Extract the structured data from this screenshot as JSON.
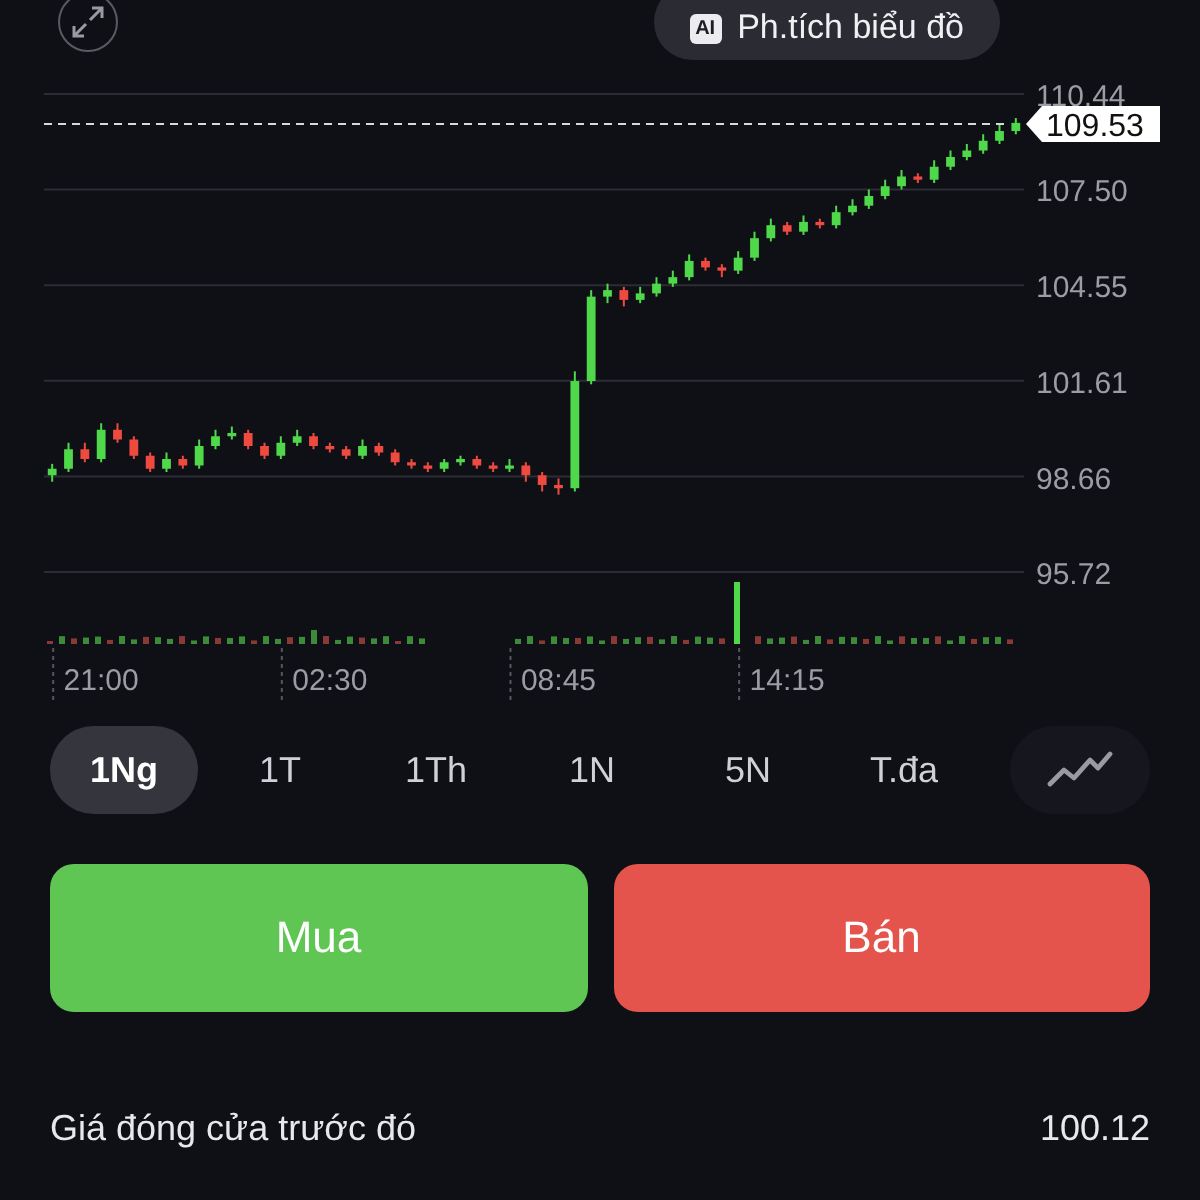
{
  "top_bar": {
    "ai_button": {
      "badge": "AI",
      "label": "Ph.tích biểu đồ"
    }
  },
  "chart": {
    "current_price": "109.53",
    "chart_data": {
      "type": "candlestick",
      "grid": true,
      "ylim": [
        95.72,
        110.44
      ],
      "categories": [
        null,
        null,
        null,
        "21:00",
        null,
        null,
        null,
        null,
        null,
        null,
        null,
        null,
        null,
        null,
        null,
        null,
        null,
        "02:30",
        null,
        null,
        null,
        null,
        null,
        null,
        null,
        null,
        null,
        null,
        null,
        null,
        null,
        "08:45",
        null,
        null,
        null,
        null,
        null,
        null,
        null,
        null,
        null,
        null,
        null,
        null,
        null,
        "14:15",
        null,
        null,
        null,
        null,
        null,
        null,
        null,
        null,
        null,
        null,
        null,
        null,
        null,
        null
      ],
      "yticks": [
        95.72,
        98.66,
        101.61,
        104.55,
        {
          "value": 107.5,
          "label": "107.50"
        },
        110.44
      ],
      "ohlc": [
        [
          98.7,
          99.05,
          98.5,
          98.9
        ],
        [
          98.9,
          99.7,
          98.8,
          99.5
        ],
        [
          99.5,
          99.7,
          99.1,
          99.2
        ],
        [
          99.2,
          100.3,
          99.1,
          100.1
        ],
        [
          100.1,
          100.3,
          99.7,
          99.8
        ],
        [
          99.8,
          99.9,
          99.2,
          99.3
        ],
        [
          99.3,
          99.4,
          98.8,
          98.9
        ],
        [
          98.9,
          99.4,
          98.8,
          99.2
        ],
        [
          99.2,
          99.3,
          98.9,
          99.0
        ],
        [
          99.0,
          99.8,
          98.9,
          99.6
        ],
        [
          99.6,
          100.1,
          99.5,
          99.9
        ],
        [
          99.9,
          100.2,
          99.8,
          100.0
        ],
        [
          100.0,
          100.1,
          99.5,
          99.6
        ],
        [
          99.6,
          99.7,
          99.2,
          99.3
        ],
        [
          99.3,
          99.9,
          99.2,
          99.7
        ],
        [
          99.7,
          100.1,
          99.6,
          99.9
        ],
        [
          99.9,
          100.0,
          99.5,
          99.6
        ],
        [
          99.6,
          99.7,
          99.4,
          99.5
        ],
        [
          99.5,
          99.6,
          99.2,
          99.3
        ],
        [
          99.3,
          99.8,
          99.2,
          99.6
        ],
        [
          99.6,
          99.7,
          99.3,
          99.4
        ],
        [
          99.4,
          99.5,
          99.0,
          99.1
        ],
        [
          99.1,
          99.2,
          98.9,
          99.0
        ],
        [
          99.0,
          99.1,
          98.8,
          98.9
        ],
        [
          98.9,
          99.2,
          98.8,
          99.1
        ],
        [
          99.1,
          99.3,
          99.0,
          99.2
        ],
        [
          99.2,
          99.3,
          98.9,
          99.0
        ],
        [
          99.0,
          99.1,
          98.8,
          98.9
        ],
        [
          98.9,
          99.2,
          98.8,
          99.0
        ],
        [
          99.0,
          99.1,
          98.5,
          98.7
        ],
        [
          98.7,
          98.8,
          98.2,
          98.4
        ],
        [
          98.4,
          98.6,
          98.1,
          98.3
        ],
        [
          98.3,
          101.9,
          98.2,
          101.6
        ],
        [
          101.6,
          104.4,
          101.5,
          104.2
        ],
        [
          104.2,
          104.6,
          104.0,
          104.4
        ],
        [
          104.4,
          104.5,
          103.9,
          104.1
        ],
        [
          104.1,
          104.5,
          104.0,
          104.3
        ],
        [
          104.3,
          104.8,
          104.2,
          104.6
        ],
        [
          104.6,
          105.0,
          104.5,
          104.8
        ],
        [
          104.8,
          105.5,
          104.7,
          105.3
        ],
        [
          105.3,
          105.4,
          105.0,
          105.1
        ],
        [
          105.1,
          105.2,
          104.8,
          105.0
        ],
        [
          105.0,
          105.6,
          104.9,
          105.4
        ],
        [
          105.4,
          106.2,
          105.3,
          106.0
        ],
        [
          106.0,
          106.6,
          105.9,
          106.4
        ],
        [
          106.4,
          106.5,
          106.1,
          106.2
        ],
        [
          106.2,
          106.7,
          106.1,
          106.5
        ],
        [
          106.5,
          106.6,
          106.3,
          106.4
        ],
        [
          106.4,
          107.0,
          106.3,
          106.8
        ],
        [
          106.8,
          107.2,
          106.7,
          107.0
        ],
        [
          107.0,
          107.5,
          106.9,
          107.3
        ],
        [
          107.3,
          107.8,
          107.2,
          107.6
        ],
        [
          107.6,
          108.1,
          107.5,
          107.9
        ],
        [
          107.9,
          108.0,
          107.7,
          107.8
        ],
        [
          107.8,
          108.4,
          107.7,
          108.2
        ],
        [
          108.2,
          108.7,
          108.1,
          108.5
        ],
        [
          108.5,
          108.9,
          108.4,
          108.7
        ],
        [
          108.7,
          109.2,
          108.6,
          109.0
        ],
        [
          109.0,
          109.5,
          108.9,
          109.3
        ],
        [
          109.3,
          109.7,
          109.2,
          109.55
        ]
      ]
    }
  },
  "ranges": [
    {
      "label": "1Ng",
      "selected": true
    },
    {
      "label": "1T",
      "selected": false
    },
    {
      "label": "1Th",
      "selected": false
    },
    {
      "label": "1N",
      "selected": false
    },
    {
      "label": "5N",
      "selected": false
    },
    {
      "label": "T.đa",
      "selected": false
    }
  ],
  "actions": [
    {
      "kind": "buy",
      "label": "Mua"
    },
    {
      "kind": "sell",
      "label": "Bán"
    }
  ],
  "previous_close": {
    "label": "Giá đóng cửa trước đó",
    "value": "100.12"
  }
}
